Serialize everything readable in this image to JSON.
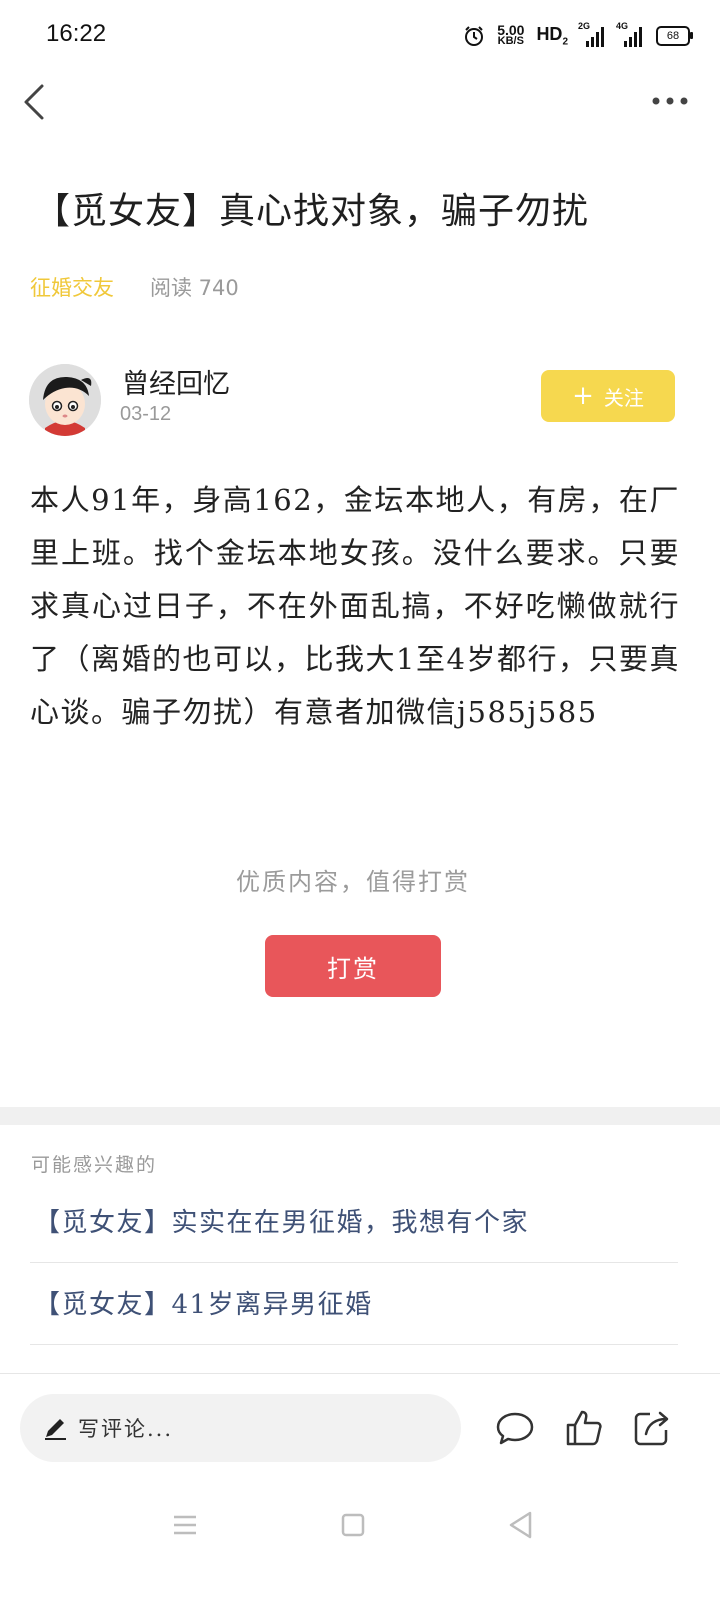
{
  "status_bar": {
    "time": "16:22",
    "net_speed_value": "5.00",
    "net_speed_unit": "KB/S",
    "hd_label": "HD",
    "hd_sub": "2",
    "sim1_tag": "2G",
    "sim2_tag": "4G",
    "battery": "68",
    "icons": [
      "alarm-icon",
      "signal-icon",
      "battery-icon"
    ]
  },
  "nav": {
    "back_icon": "back-icon",
    "more_icon": "more-icon"
  },
  "article": {
    "title": "【觅女友】真心找对象，骗子勿扰",
    "category": "征婚交友",
    "read_label": "阅读 740",
    "author": "曾经回忆",
    "date": "03-12",
    "follow_label": "关注",
    "follow_icon": "plus-icon",
    "body": "本人91年，身高162，金坛本地人，有房，在厂里上班。找个金坛本地女孩。没什么要求。只要求真心过日子，不在外面乱搞，不好吃懒做就行了（离婚的也可以，比我大1至4岁都行，只要真心谈。骗子勿扰）有意者加微信j585j585"
  },
  "reward": {
    "hint": "优质内容，值得打赏",
    "button_label": "打赏"
  },
  "recommend": {
    "section_title": "可能感兴趣的",
    "items": [
      {
        "title": "【觅女友】实实在在男征婚，我想有个家"
      },
      {
        "title": "【觅女友】41岁离异男征婚"
      }
    ]
  },
  "bottom_bar": {
    "comment_placeholder": "写评论...",
    "icons": [
      "pen-icon",
      "comment-icon",
      "like-icon",
      "share-icon"
    ]
  },
  "system_nav": {
    "icons": [
      "menu-icon",
      "home-icon",
      "back-triangle-icon"
    ]
  },
  "colors": {
    "category": "#f0c83a",
    "follow_button": "#f6d84f",
    "reward_button": "#e8565a",
    "link_text": "#3f5176"
  }
}
